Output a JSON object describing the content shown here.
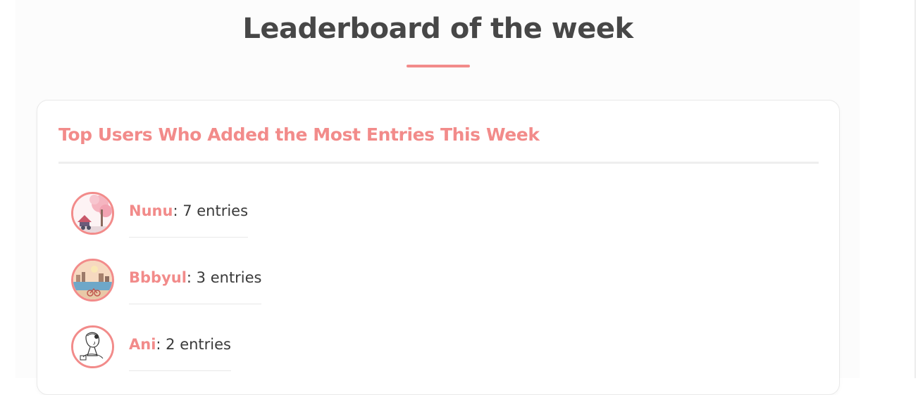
{
  "page": {
    "title": "Leaderboard of the week"
  },
  "colors": {
    "accent": "#f28b8a",
    "title_text": "#474747",
    "body_text": "#3a3a3a"
  },
  "leaderboard": {
    "heading": "Top Users Who Added the Most Entries This Week",
    "users": [
      {
        "name": "Nunu",
        "entries_text": ": 7 entries",
        "entries": 7,
        "avatar_icon": "cherry-blossom-avatar-icon"
      },
      {
        "name": "Bbbyul",
        "entries_text": ": 3 entries",
        "entries": 3,
        "avatar_icon": "city-river-bike-avatar-icon"
      },
      {
        "name": "Ani",
        "entries_text": ": 2 entries",
        "entries": 2,
        "avatar_icon": "line-art-girl-avatar-icon"
      }
    ]
  }
}
